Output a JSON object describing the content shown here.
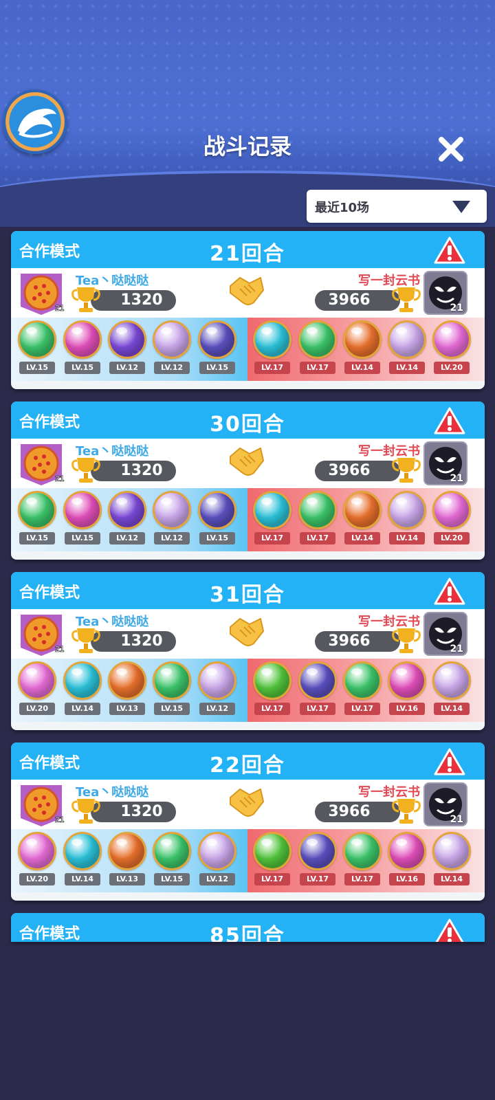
{
  "header": {
    "title": "战斗记录",
    "close_icon": "close-icon",
    "filter": {
      "selected": "最近10场"
    }
  },
  "colors": {
    "card_header": "#23b2f5",
    "left_name": "#3da9e6",
    "right_name": "#e14a55",
    "background": "#2b2a4a"
  },
  "records": [
    {
      "mode": "合作模式",
      "rounds": "21回合",
      "left": {
        "name": "Tea丶哒哒哒",
        "score": "1320",
        "rank_level": "21"
      },
      "right": {
        "name": "写一封云书",
        "score": "3966",
        "avatar_level": "21"
      },
      "left_balls": [
        {
          "lv": "LV.15",
          "color": "#3cc46a"
        },
        {
          "lv": "LV.15",
          "color": "#e04fb9"
        },
        {
          "lv": "LV.12",
          "color": "#7a48d6"
        },
        {
          "lv": "LV.12",
          "color": "#c9a6e8"
        },
        {
          "lv": "LV.15",
          "color": "#5b4fbf"
        }
      ],
      "right_balls": [
        {
          "lv": "LV.17",
          "color": "#2bc1d8"
        },
        {
          "lv": "LV.17",
          "color": "#3cc46a"
        },
        {
          "lv": "LV.14",
          "color": "#e8702c"
        },
        {
          "lv": "LV.14",
          "color": "#c9a6e8"
        },
        {
          "lv": "LV.20",
          "color": "#e46bd5"
        }
      ]
    },
    {
      "mode": "合作模式",
      "rounds": "30回合",
      "left": {
        "name": "Tea丶哒哒哒",
        "score": "1320",
        "rank_level": "21"
      },
      "right": {
        "name": "写一封云书",
        "score": "3966",
        "avatar_level": "21"
      },
      "left_balls": [
        {
          "lv": "LV.15",
          "color": "#3cc46a"
        },
        {
          "lv": "LV.15",
          "color": "#e04fb9"
        },
        {
          "lv": "LV.12",
          "color": "#7a48d6"
        },
        {
          "lv": "LV.12",
          "color": "#c9a6e8"
        },
        {
          "lv": "LV.15",
          "color": "#5b4fbf"
        }
      ],
      "right_balls": [
        {
          "lv": "LV.17",
          "color": "#2bc1d8"
        },
        {
          "lv": "LV.17",
          "color": "#3cc46a"
        },
        {
          "lv": "LV.14",
          "color": "#e8702c"
        },
        {
          "lv": "LV.14",
          "color": "#c9a6e8"
        },
        {
          "lv": "LV.20",
          "color": "#e46bd5"
        }
      ]
    },
    {
      "mode": "合作模式",
      "rounds": "31回合",
      "left": {
        "name": "Tea丶哒哒哒",
        "score": "1320",
        "rank_level": "21"
      },
      "right": {
        "name": "写一封云书",
        "score": "3966",
        "avatar_level": "21"
      },
      "left_balls": [
        {
          "lv": "LV.20",
          "color": "#e46bd5"
        },
        {
          "lv": "LV.14",
          "color": "#2bc1d8"
        },
        {
          "lv": "LV.13",
          "color": "#e8702c"
        },
        {
          "lv": "LV.15",
          "color": "#3cc46a"
        },
        {
          "lv": "LV.12",
          "color": "#c9a6e8"
        }
      ],
      "right_balls": [
        {
          "lv": "LV.17",
          "color": "#52c43c"
        },
        {
          "lv": "LV.17",
          "color": "#5b4fbf"
        },
        {
          "lv": "LV.17",
          "color": "#3cc46a"
        },
        {
          "lv": "LV.16",
          "color": "#e04fb9"
        },
        {
          "lv": "LV.14",
          "color": "#c9a6e8"
        }
      ]
    },
    {
      "mode": "合作模式",
      "rounds": "22回合",
      "left": {
        "name": "Tea丶哒哒哒",
        "score": "1320",
        "rank_level": "21"
      },
      "right": {
        "name": "写一封云书",
        "score": "3966",
        "avatar_level": "21"
      },
      "left_balls": [
        {
          "lv": "LV.20",
          "color": "#e46bd5"
        },
        {
          "lv": "LV.14",
          "color": "#2bc1d8"
        },
        {
          "lv": "LV.13",
          "color": "#e8702c"
        },
        {
          "lv": "LV.15",
          "color": "#3cc46a"
        },
        {
          "lv": "LV.12",
          "color": "#c9a6e8"
        }
      ],
      "right_balls": [
        {
          "lv": "LV.17",
          "color": "#52c43c"
        },
        {
          "lv": "LV.17",
          "color": "#5b4fbf"
        },
        {
          "lv": "LV.17",
          "color": "#3cc46a"
        },
        {
          "lv": "LV.16",
          "color": "#e04fb9"
        },
        {
          "lv": "LV.14",
          "color": "#c9a6e8"
        }
      ]
    },
    {
      "mode": "合作模式",
      "rounds": "85回合"
    }
  ]
}
